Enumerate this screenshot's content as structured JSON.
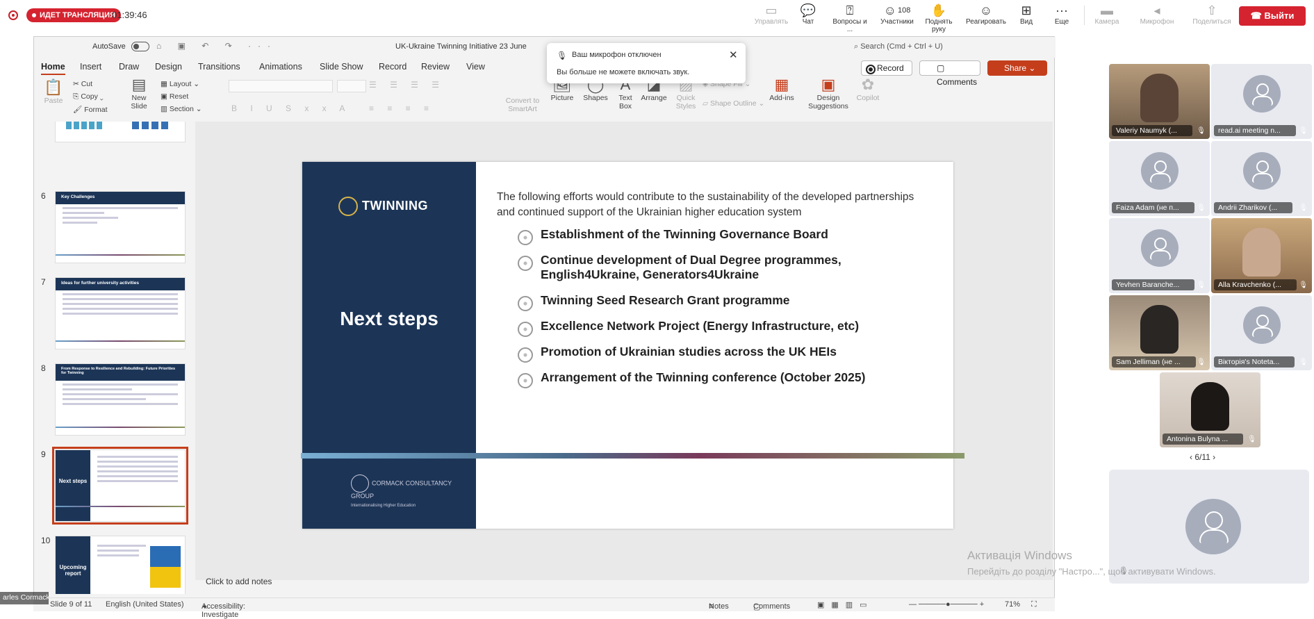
{
  "meeting": {
    "live_badge": "ИДЕТ ТРАНСЛЯЦИЯ",
    "timer": "01:39:46",
    "toolbar": [
      {
        "label": "Управлять",
        "icon": "screen-icon",
        "disabled": true
      },
      {
        "label": "Чат",
        "icon": "chat-icon"
      },
      {
        "label": "Вопросы и ...",
        "icon": "qa-icon"
      },
      {
        "label": "Участники",
        "icon": "participants-icon",
        "count": "108"
      },
      {
        "label": "Поднять руку",
        "icon": "hand-icon"
      },
      {
        "label": "Реагировать",
        "icon": "smile-icon"
      },
      {
        "label": "Вид",
        "icon": "grid-icon"
      },
      {
        "label": "Еще",
        "icon": "more-icon"
      },
      {
        "label": "Камера",
        "icon": "camera-off-icon",
        "disabled": true
      },
      {
        "label": "Микрофон",
        "icon": "mic-off-icon",
        "disabled": true
      },
      {
        "label": "Поделиться",
        "icon": "share-icon",
        "disabled": true
      }
    ],
    "leave_label": "Выйти",
    "popup": {
      "title": "Ваш микрофон отключен",
      "text": "Вы больше не можете включать звук."
    },
    "participants": [
      {
        "name": "Valeriy Naumyk (...",
        "video": true
      },
      {
        "name": "read.ai meeting n...",
        "video": false
      },
      {
        "name": "Faiza Adam (не п...",
        "video": false
      },
      {
        "name": "Andrii Zharikov (...",
        "video": false
      },
      {
        "name": "Yevhen Baranche...",
        "video": false
      },
      {
        "name": "Alla Kravchenko (...",
        "video": true
      },
      {
        "name": "Sam Jelliman (не ...",
        "video": true
      },
      {
        "name": "Вікторія's Noteta...",
        "video": false
      },
      {
        "name": "Antonina Bulyna ...",
        "video": true
      }
    ],
    "pager": "6/11",
    "speaker_label": "arles Cormack",
    "windows_activation": {
      "line1": "Активація Windows",
      "line2": "Перейдіть до розділу \"Настро...\", щоб активувати Windows."
    }
  },
  "ppt": {
    "autosave": "AutoSave",
    "doc_title": "UK-Ukraine Twinning Initiative 23 June",
    "search": "Search (Cmd + Ctrl + U)",
    "menu": [
      "Home",
      "Insert",
      "Draw",
      "Design",
      "Transitions",
      "Animations",
      "Slide Show",
      "Record",
      "Review",
      "View"
    ],
    "record_btn": "Record",
    "comments_btn": "Comments",
    "share_btn": "Share",
    "ribbon": {
      "paste": "Paste",
      "cut": "Cut",
      "copy": "Copy",
      "format": "Format",
      "new_slide": "New Slide",
      "layout": "Layout",
      "reset": "Reset",
      "section": "Section",
      "convert": "Convert to SmartArt",
      "picture": "Picture",
      "shapes": "Shapes",
      "textbox": "Text Box",
      "arrange": "Arrange",
      "quick_styles": "Quick Styles",
      "shape_fill": "Shape Fill",
      "shape_outline": "Shape Outline",
      "addins": "Add-ins",
      "design_suggestions": "Design Suggestions",
      "copilot": "Copilot"
    },
    "thumbnails": [
      {
        "num": "6",
        "title": "Key Challenges"
      },
      {
        "num": "7",
        "title": "Ideas for further university activities"
      },
      {
        "num": "8",
        "title": "From Response to Resilience and Rebuilding: Future Priorities for Twinning"
      },
      {
        "num": "9",
        "title": "Next steps",
        "selected": true
      },
      {
        "num": "10",
        "title": "Upcoming report"
      }
    ],
    "slide": {
      "logo": "TWINNING",
      "heading": "Next steps",
      "intro": "The following efforts would contribute to the sustainability of the developed partnerships and continued support of the Ukrainian higher education system",
      "bullets": [
        "Establishment of the Twinning Governance Board",
        "Continue development of Dual Degree programmes, English4Ukraine, Generators4Ukraine",
        "Twinning Seed Research Grant programme",
        "Excellence Network Project  (Energy Infrastructure, etc)",
        "Promotion of Ukrainian studies across the UK HEIs",
        "Arrangement of the Twinning conference (October 2025)"
      ],
      "footer_logo": "CORMACK CONSULTANCY GROUP",
      "footer_tag": "Internationalising Higher Education"
    },
    "notes": "Click to add notes",
    "status": {
      "slide": "Slide 9 of 11",
      "language": "English (United States)",
      "accessibility": "Accessibility: Investigate",
      "notes": "Notes",
      "comments": "Comments",
      "zoom": "71%"
    }
  }
}
